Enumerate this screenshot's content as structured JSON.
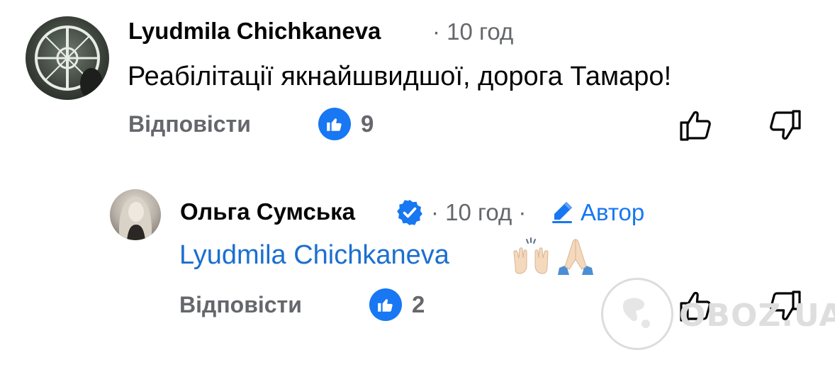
{
  "comment1": {
    "author": "Lyudmila Chichkaneva",
    "time": "· 10 год",
    "text": "Реабілітації  якнайшвидшої, дорога Тамаро!",
    "reply_label": "Відповісти",
    "like_count": "9"
  },
  "comment2": {
    "author": "Ольга Сумська",
    "time": "· 10 год ·",
    "author_badge": "Автор",
    "mention": "Lyudmila Chichkaneva",
    "emojis": [
      "raising-hands",
      "folded-hands"
    ],
    "reply_label": "Відповісти",
    "like_count": "2"
  },
  "watermark": "OBOZ.UA",
  "colors": {
    "accent": "#1877f2",
    "mention": "#1b6fd0",
    "secondary_text": "#65676b"
  }
}
